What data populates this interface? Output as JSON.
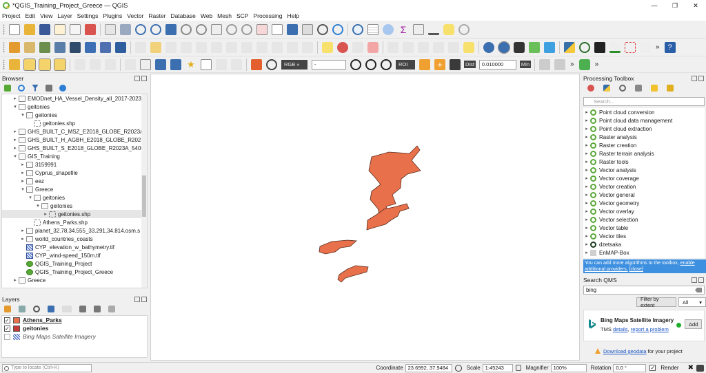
{
  "window": {
    "title": "*QGIS_Training_Project_Greece — QGIS",
    "minimize": "—",
    "maximize": "❐",
    "close": "✕"
  },
  "menu": [
    "Project",
    "Edit",
    "View",
    "Layer",
    "Settings",
    "Plugins",
    "Vector",
    "Raster",
    "Database",
    "Web",
    "Mesh",
    "SCP",
    "Processing",
    "Help"
  ],
  "toolbar3": {
    "rgb_combo": "RGB »",
    "band_combo": "-",
    "roi_label": "ROI",
    "dist_label": "Dist",
    "dist_value": "0.010000",
    "min_label": "Min"
  },
  "browser": {
    "title": "Browser",
    "tree": [
      {
        "label": "EMODnet_HA_Vessel_Density_all_2017-2023",
        "depth": 2,
        "arrow": "▸",
        "icon": "folder"
      },
      {
        "label": "geitonies",
        "depth": 2,
        "arrow": "▾",
        "icon": "folder"
      },
      {
        "label": "geitonies",
        "depth": 3,
        "arrow": "▾",
        "icon": "folder"
      },
      {
        "label": "geitonies.shp",
        "depth": 4,
        "arrow": "",
        "icon": "shp"
      },
      {
        "label": "GHS_BUILT_C_MSZ_E2018_GLOBE_R2023A_5",
        "depth": 2,
        "arrow": "▸",
        "icon": "folder"
      },
      {
        "label": "GHS_BUILT_H_AGBH_E2018_GLOBE_R2023A",
        "depth": 2,
        "arrow": "▸",
        "icon": "folder"
      },
      {
        "label": "GHS_BUILT_S_E2018_GLOBE_R2023A_54009",
        "depth": 2,
        "arrow": "▸",
        "icon": "folder"
      },
      {
        "label": "GIS_Training",
        "depth": 2,
        "arrow": "▾",
        "icon": "folder"
      },
      {
        "label": "3159991",
        "depth": 3,
        "arrow": "▸",
        "icon": "folder"
      },
      {
        "label": "Cyprus_shapefile",
        "depth": 3,
        "arrow": "▸",
        "icon": "folder"
      },
      {
        "label": "eez",
        "depth": 3,
        "arrow": "▸",
        "icon": "folder"
      },
      {
        "label": "Greece",
        "depth": 3,
        "arrow": "▾",
        "icon": "folder"
      },
      {
        "label": "geitonies",
        "depth": 4,
        "arrow": "▾",
        "icon": "folder"
      },
      {
        "label": "geitonies",
        "depth": 5,
        "arrow": "▾",
        "icon": "folder"
      },
      {
        "label": "geitonies.shp",
        "depth": 6,
        "arrow": "▸",
        "icon": "shp",
        "selected": true
      },
      {
        "label": "Athens_Parks.shp",
        "depth": 4,
        "arrow": "",
        "icon": "shp"
      },
      {
        "label": "planet_32.78,34.555_33.291,34.814.osm.s",
        "depth": 3,
        "arrow": "▸",
        "icon": "folder"
      },
      {
        "label": "world_countries_coasts",
        "depth": 3,
        "arrow": "▸",
        "icon": "folder"
      },
      {
        "label": "CYP_elevation_w_bathymetry.tif",
        "depth": 3,
        "arrow": "",
        "icon": "raster"
      },
      {
        "label": "CYP_wind-speed_150m.tif",
        "depth": 3,
        "arrow": "",
        "icon": "raster"
      },
      {
        "label": "QGIS_Training_Project",
        "depth": 3,
        "arrow": "",
        "icon": "qgis"
      },
      {
        "label": "QGIS_Training_Project_Greece",
        "depth": 3,
        "arrow": "",
        "icon": "qgis"
      },
      {
        "label": "Greece",
        "depth": 2,
        "arrow": "▸",
        "icon": "folder"
      }
    ]
  },
  "layers": {
    "title": "Layers",
    "items": [
      {
        "label": "Athens_Parks",
        "checked": "✓",
        "swatch": "#e8704b",
        "bold": true,
        "underline": true
      },
      {
        "label": "geitonies",
        "checked": "✓",
        "swatch": "#c73a3a",
        "bold": true
      },
      {
        "label": "Bing Maps Satellite Imagery",
        "checked": "",
        "swatch": "raster",
        "italic": true
      }
    ]
  },
  "map": {
    "fill_color": "#e8704b",
    "stroke_color": "#5a2d1e"
  },
  "toolbox": {
    "title": "Processing Toolbox",
    "search_placeholder": "Search...",
    "items": [
      "Point cloud conversion",
      "Point cloud data management",
      "Point cloud extraction",
      "Raster analysis",
      "Raster creation",
      "Raster terrain analysis",
      "Raster tools",
      "Vector analysis",
      "Vector coverage",
      "Vector creation",
      "Vector general",
      "Vector geometry",
      "Vector overlay",
      "Vector selection",
      "Vector table",
      "Vector tiles",
      "dzetsaka",
      "EnMAP-Box"
    ],
    "info_text": "You can add more algorithms to the toolbox,",
    "info_link1": "enable additional providers.",
    "info_link2": "[close]"
  },
  "qms": {
    "title": "Search QMS",
    "search_value": "bing",
    "filter_button": "Filter by extent",
    "filter_select": "All",
    "service_name": "Bing Maps Satellite Imagery",
    "service_type": "TMS",
    "details_link": "details",
    "report_link": "report a problem",
    "add_button": "Add",
    "download_link": "Download geodata",
    "download_suffix": "for your project"
  },
  "status": {
    "locator_placeholder": "Type to locate (Ctrl+K)",
    "coordinate_label": "Coordinate",
    "coordinate_value": "23.6992, 37.9484",
    "scale_label": "Scale",
    "scale_value": "1:45243",
    "magnifier_label": "Magnifier",
    "magnifier_value": "100%",
    "rotation_label": "Rotation",
    "rotation_value": "0.0 °",
    "render_label": "Render",
    "render_checked": "✓"
  }
}
